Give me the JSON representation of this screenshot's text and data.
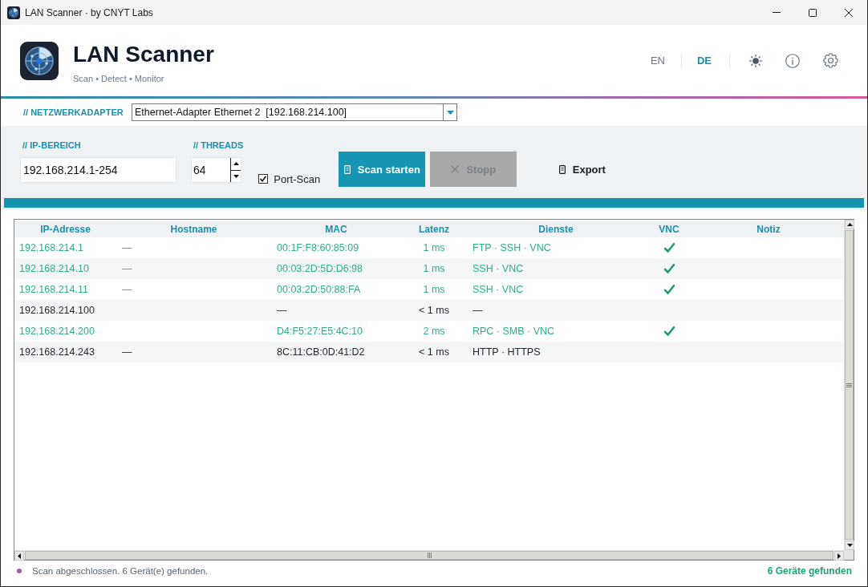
{
  "window": {
    "title": "LAN Scanner · by CNYT Labs"
  },
  "header": {
    "title": "LAN Scanner",
    "tagline": "Scan • Detect • Monitor",
    "languages": [
      {
        "label": "EN",
        "selected": false
      },
      {
        "label": "DE",
        "selected": true
      }
    ]
  },
  "adapter": {
    "label": "// NETZWERKADAPTER",
    "value": "Ethernet-Adapter Ethernet 2  [192.168.214.100]"
  },
  "scan": {
    "ip_range": {
      "label": "// IP-BEREICH",
      "value": "192.168.214.1-254"
    },
    "threads": {
      "label": "// THREADS",
      "value": "64"
    },
    "port_scan": {
      "label": "Port-Scan",
      "checked": true
    },
    "buttons": [
      {
        "kind": "start",
        "label": "Scan starten",
        "disabled": false
      },
      {
        "kind": "stop",
        "label": "Stopp",
        "disabled": true
      },
      {
        "kind": "export",
        "label": "Export",
        "disabled": false
      }
    ]
  },
  "progress": {
    "level": 1
  },
  "table": {
    "columns": [
      "IP-Adresse",
      "Hostname",
      "MAC",
      "Latenz",
      "Dienste",
      "VNC",
      "Notiz"
    ],
    "rows": [
      {
        "ip": "192.168.214.1",
        "hostname": "—",
        "mac": "00:1F:F8:60:85:09",
        "latency": "1 ms",
        "services": "FTP · SSH · VNC",
        "vnc": true
      },
      {
        "ip": "192.168.214.10",
        "hostname": "—",
        "mac": "00:03:2D:5D:D6:98",
        "latency": "1 ms",
        "services": "SSH · VNC",
        "vnc": true
      },
      {
        "ip": "192.168.214.11",
        "hostname": "—",
        "mac": "00:03:2D:50:88:FA",
        "latency": "1 ms",
        "services": "SSH · VNC",
        "vnc": true
      },
      {
        "ip": "192.168.214.100",
        "mac": "—",
        "latency": "< 1 ms",
        "services": "—",
        "vnc": false
      },
      {
        "ip": "192.168.214.200",
        "mac": "D4:F5:27:E5:4C:10",
        "latency": "2 ms",
        "services": "RPC · SMB · VNC",
        "vnc": true
      },
      {
        "ip": "192.168.214.243",
        "hostname": "—",
        "mac": "8C:11:CB:0D:41:D2",
        "latency": "< 1 ms",
        "services": "HTTP · HTTPS",
        "vnc": false
      }
    ]
  },
  "status_bar": {
    "message": "Scan abgeschlossen. 6 Gerät(e) gefunden.",
    "summary": "6 Geräte gefunden"
  }
}
